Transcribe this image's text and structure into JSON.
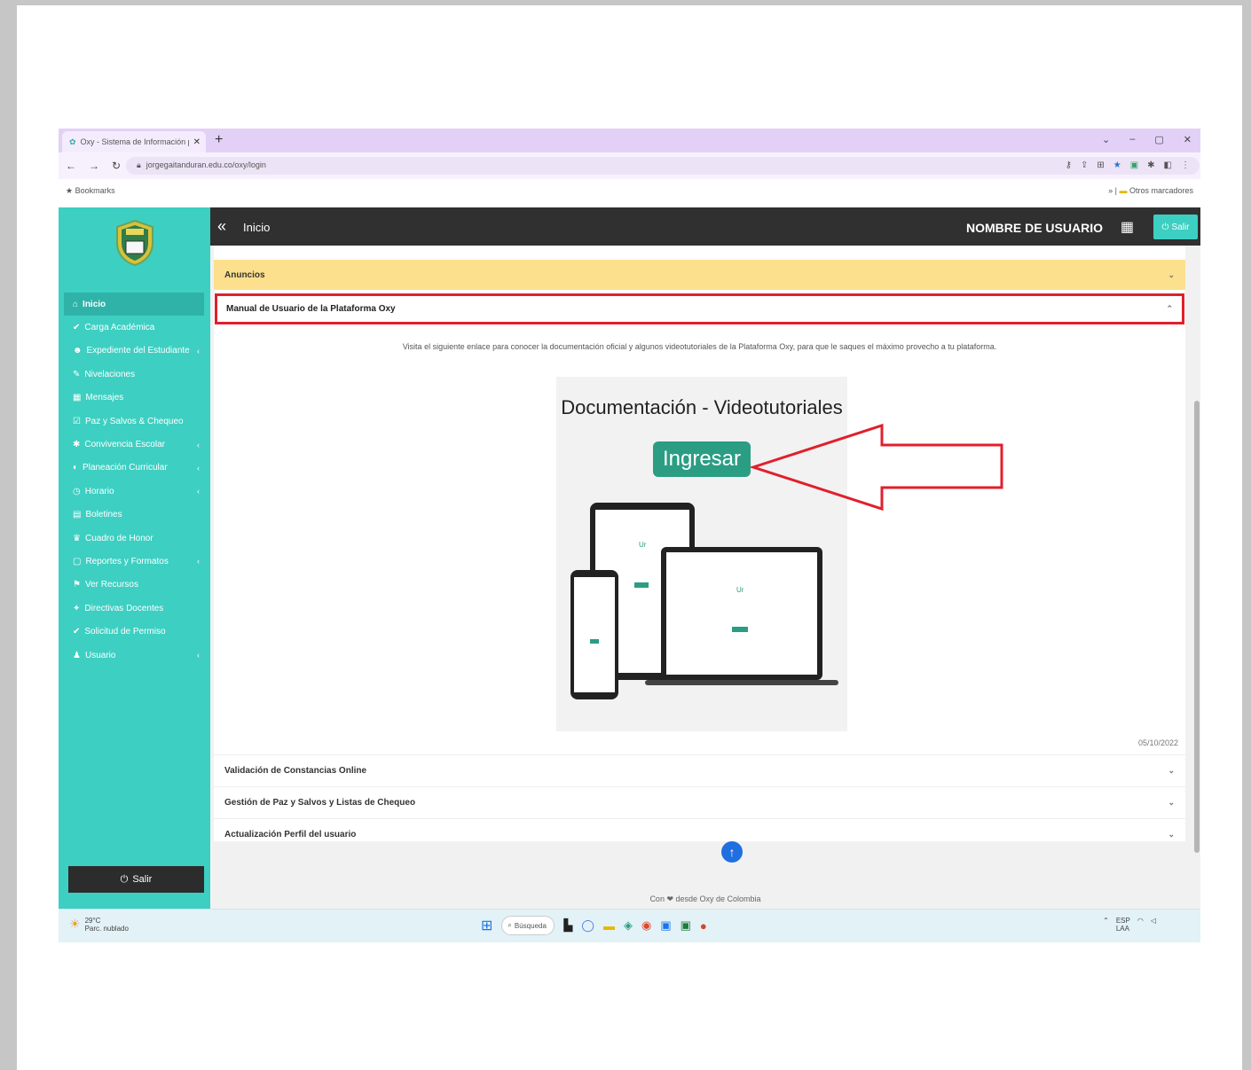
{
  "browser": {
    "tab_title": "Oxy - Sistema de Información p",
    "tab_close": "✕",
    "new_tab": "+",
    "url": "jorgegaitanduran.edu.co/oxy/login",
    "bookmark_left": "Bookmarks",
    "bookmark_right": "Otros marcadores",
    "window_controls": [
      "⌄",
      "–",
      "▢",
      "✕"
    ]
  },
  "sidebar": {
    "items": [
      {
        "icon": "⌂",
        "label": "Inicio",
        "active": true,
        "caret": false
      },
      {
        "icon": "✔",
        "label": "Carga Académica",
        "active": false,
        "caret": false
      },
      {
        "icon": "☻",
        "label": "Expediente del Estudiante",
        "active": false,
        "caret": true
      },
      {
        "icon": "✎",
        "label": "Nivelaciones",
        "active": false,
        "caret": false
      },
      {
        "icon": "▦",
        "label": "Mensajes",
        "active": false,
        "caret": false
      },
      {
        "icon": "☑",
        "label": "Paz y Salvos & Chequeo",
        "active": false,
        "caret": false
      },
      {
        "icon": "✱",
        "label": "Convivencia Escolar",
        "active": false,
        "caret": true
      },
      {
        "icon": "◐",
        "label": "Planeación Curricular",
        "active": false,
        "caret": true
      },
      {
        "icon": "◷",
        "label": "Horario",
        "active": false,
        "caret": true
      },
      {
        "icon": "▤",
        "label": "Boletines",
        "active": false,
        "caret": false
      },
      {
        "icon": "♛",
        "label": "Cuadro de Honor",
        "active": false,
        "caret": false
      },
      {
        "icon": "▢",
        "label": "Reportes y Formatos",
        "active": false,
        "caret": true
      },
      {
        "icon": "⚑",
        "label": "Ver Recursos",
        "active": false,
        "caret": false
      },
      {
        "icon": "✦",
        "label": "Directivas Docentes",
        "active": false,
        "caret": false
      },
      {
        "icon": "✔",
        "label": "Solicitud de Permiso",
        "active": false,
        "caret": false
      },
      {
        "icon": "♟",
        "label": "Usuario",
        "active": false,
        "caret": true
      }
    ],
    "logout_label": "Salir"
  },
  "topbar": {
    "title": "Inicio",
    "username": "NOMBRE DE USUARIO",
    "exit_label": "Salir"
  },
  "content": {
    "announcements_label": "Anuncios",
    "manual_title": "Manual de Usuario de la Plataforma Oxy",
    "description": "Visita el siguiente enlace para conocer la documentación oficial y algunos videotutoriales de la Plataforma Oxy, para que le saques el máximo provecho a tu plataforma.",
    "doc_title": "Documentación - Videotutoriales",
    "doc_button": "Ingresar",
    "date": "05/10/2022",
    "accordions": [
      "Validación de Constancias Online",
      "Gestión de Paz y Salvos y Listas de Chequeo",
      "Actualización Perfil del usuario"
    ],
    "footer": "Con ❤ desde Oxy de Colombia"
  },
  "taskbar": {
    "temp": "29°C",
    "weather": "Parc. nublado",
    "search": "Búsqueda",
    "lang": "ESP",
    "lang2": "LAA"
  },
  "colors": {
    "sidebar": "#3dcfc2",
    "topbar": "#303030",
    "announcement": "#fde08d",
    "highlight": "#e0202c",
    "button": "#2a9d83"
  }
}
